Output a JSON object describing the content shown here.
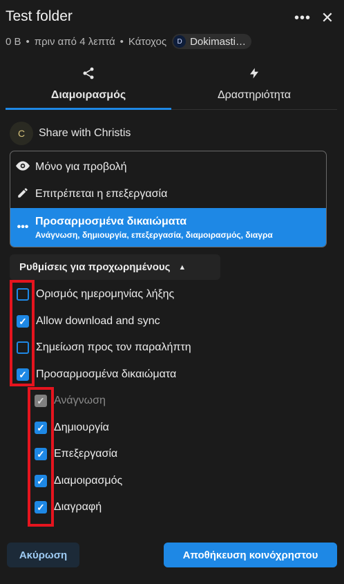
{
  "header": {
    "title": "Test folder",
    "more_icon": "more-horizontal-icon",
    "close_icon": "close-icon"
  },
  "meta": {
    "size": "0 B",
    "modified": "πριν από 4 λεπτά",
    "owner_label": "Κάτοχος",
    "owner_initial": "D",
    "owner_name": "Dokimasti…"
  },
  "tabs": [
    {
      "label": "Διαμοιρασμός",
      "icon": "share-icon",
      "active": true
    },
    {
      "label": "Δραστηριότητα",
      "icon": "lightning-icon",
      "active": false
    }
  ],
  "share": {
    "avatar_initial": "C",
    "label": "Share with Christis"
  },
  "permissions": {
    "options": [
      {
        "label": "Μόνο για προβολή",
        "icon": "eye-icon"
      },
      {
        "label": "Επιτρέπεται η επεξεργασία",
        "icon": "pencil-icon"
      },
      {
        "label": "Προσαρμοσμένα δικαιώματα",
        "icon": "more-horizontal-icon",
        "selected": true,
        "subtitle": "Ανάγνωση, δημιουργία, επεξεργασία, διαμοιρασμός, διαγρα"
      }
    ]
  },
  "advanced": {
    "label": "Ρυθμίσεις για προχωρημένους",
    "icon": "caret-up-icon"
  },
  "checkboxes": [
    {
      "label": "Ορισμός ημερομηνίας λήξης",
      "checked": false
    },
    {
      "label": "Allow download and sync",
      "checked": true
    },
    {
      "label": "Σημείωση προς τον παραλήπτη",
      "checked": false
    },
    {
      "label": "Προσαρμοσμένα δικαιώματα",
      "checked": true
    }
  ],
  "sub_checkboxes": [
    {
      "label": "Ανάγνωση",
      "checked": true,
      "disabled": true
    },
    {
      "label": "Δημιουργία",
      "checked": true,
      "disabled": false
    },
    {
      "label": "Επεξεργασία",
      "checked": true,
      "disabled": false
    },
    {
      "label": "Διαμοιρασμός",
      "checked": true,
      "disabled": false
    },
    {
      "label": "Διαγραφή",
      "checked": true,
      "disabled": false
    }
  ],
  "footer": {
    "cancel_label": "Ακύρωση",
    "save_label": "Αποθήκευση κοινόχρηστου"
  },
  "colors": {
    "accent": "#1e88e5",
    "highlight": "#e5141e",
    "background": "#1b1b1b"
  }
}
